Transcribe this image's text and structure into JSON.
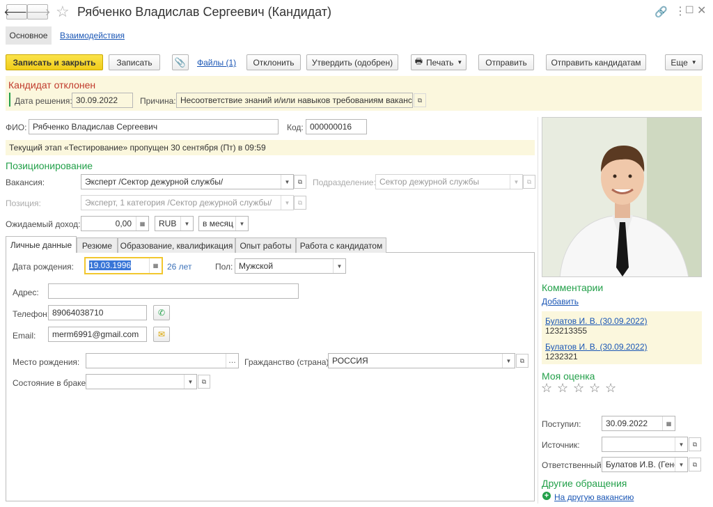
{
  "window": {
    "title": "Рябченко Владислав Сергеевич (Кандидат)"
  },
  "nav_tabs": [
    {
      "label": "Основное"
    },
    {
      "label": "Взаимодействия"
    }
  ],
  "toolbar": {
    "save_close": "Записать и закрыть",
    "save": "Записать",
    "files": "Файлы (1)",
    "reject": "Отклонить",
    "approve": "Утвердить (одобрен)",
    "print": "Печать",
    "send": "Отправить",
    "send_candidates": "Отправить кандидатам",
    "more": "Еще"
  },
  "rejection": {
    "heading": "Кандидат отклонен",
    "date_label": "Дата решения:",
    "date_value": "30.09.2022",
    "reason_label": "Причина:",
    "reason_value": "Несоответствие знаний и/или навыков требованиям вакансии"
  },
  "fio": {
    "label": "ФИО:",
    "value": "Рябченко Владислав Сергеевич"
  },
  "code": {
    "label": "Код:",
    "value": "000000016"
  },
  "stage_notice": "Текущий этап «Тестирование» пропущен 30 сентября (Пт) в 09:59",
  "positioning": {
    "heading": "Позиционирование",
    "vacancy_label": "Вакансия:",
    "vacancy_value": "Эксперт /Сектор дежурной службы/",
    "division_label": "Подразделение:",
    "division_value": "Сектор дежурной службы",
    "position_label": "Позиция:",
    "position_value": "Эксперт, 1 категория /Сектор дежурной службы/",
    "income_label": "Ожидаемый доход:",
    "income_value": "0,00",
    "currency": "RUB",
    "period": "в месяц"
  },
  "tabs": [
    {
      "label": "Личные данные"
    },
    {
      "label": "Резюме"
    },
    {
      "label": "Образование, квалификация"
    },
    {
      "label": "Опыт работы"
    },
    {
      "label": "Работа с кандидатом"
    }
  ],
  "personal": {
    "birth_label": "Дата рождения:",
    "birth_value": "19.03.1996",
    "age": "26 лет",
    "gender_label": "Пол:",
    "gender_value": "Мужской",
    "address_label": "Адрес:",
    "address_value": "",
    "phone_label": "Телефон:",
    "phone_value": "89064038710",
    "email_label": "Email:",
    "email_value": "merm6991@gmail.com",
    "birthplace_label": "Место рождения:",
    "birthplace_value": "",
    "citizenship_label": "Гражданство (страна):",
    "citizenship_value": "РОССИЯ",
    "marital_label": "Состояние в браке:",
    "marital_value": ""
  },
  "comments": {
    "heading": "Комментарии",
    "add": "Добавить",
    "items": [
      {
        "author": "Булатов И. В. (30.09.2022)",
        "text": "123213355"
      },
      {
        "author": "Булатов И. В. (30.09.2022)",
        "text": "1232321"
      }
    ]
  },
  "rating": {
    "heading": "Моя оценка",
    "value": 0,
    "max": 5
  },
  "meta": {
    "received_label": "Поступил:",
    "received_value": "30.09.2022",
    "source_label": "Источник:",
    "source_value": "",
    "responsible_label": "Ответственный:",
    "responsible_value": "Булатов И.В. (Гене"
  },
  "other": {
    "heading": "Другие обращения",
    "link": "На другую вакансию"
  },
  "colors": {
    "accent_yellow": "#f6d72a",
    "notice_bg": "#fbf7dd",
    "green": "#23a04a",
    "link": "#1a56b5",
    "rejected_red": "#c0392b"
  }
}
